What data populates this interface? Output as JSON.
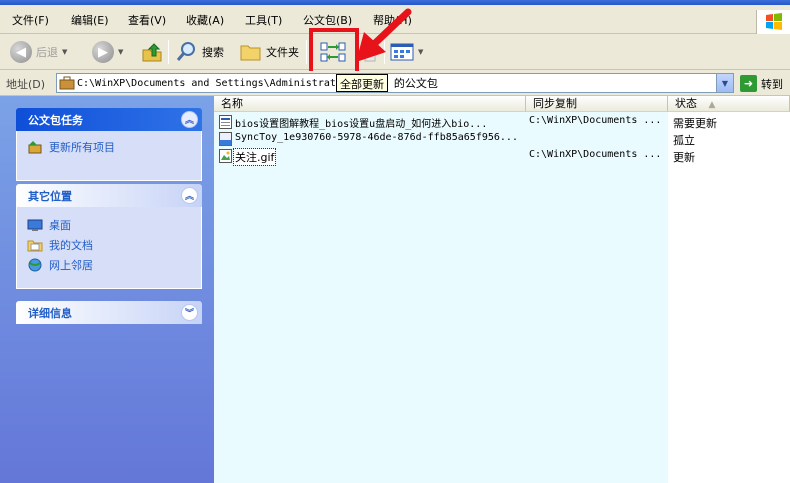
{
  "menu": [
    {
      "label": "文件(F)",
      "name": "menu-file"
    },
    {
      "label": "编辑(E)",
      "name": "menu-edit"
    },
    {
      "label": "查看(V)",
      "name": "menu-view"
    },
    {
      "label": "收藏(A)",
      "name": "menu-favorites"
    },
    {
      "label": "工具(T)",
      "name": "menu-tools"
    },
    {
      "label": "公文包(B)",
      "name": "menu-briefcase"
    },
    {
      "label": "帮助(H)",
      "name": "menu-help"
    }
  ],
  "toolbar": {
    "back_label": "后退",
    "search_label": "搜索",
    "folders_label": "文件夹"
  },
  "address": {
    "label": "地址(D)",
    "value": "C:\\WinXP\\Documents and Settings\\Administrat",
    "value_tail": "的公文包",
    "go_label": "转到"
  },
  "tooltip": "全部更新",
  "taskpane": {
    "briefcase_tasks": {
      "title": "公文包任务",
      "items": [
        "更新所有项目"
      ]
    },
    "other_places": {
      "title": "其它位置",
      "items": [
        "桌面",
        "我的文档",
        "网上邻居"
      ]
    },
    "details": {
      "title": "详细信息"
    }
  },
  "columns": {
    "name": "名称",
    "sync": "同步复制",
    "status": "状态"
  },
  "files": [
    {
      "name": "bios设置图解教程_bios设置u盘启动_如何进入bio...",
      "sync": "C:\\WinXP\\Documents ...",
      "status": "需要更新",
      "icon": "webpage-file-icon"
    },
    {
      "name": "SyncToy_1e930760-5978-46de-876d-ffb85a65f956...",
      "sync": "",
      "status": "孤立",
      "icon": "dat-file-icon"
    },
    {
      "name": "关注.gif",
      "sync": "C:\\WinXP\\Documents ...",
      "status": "更新",
      "icon": "image-file-icon"
    }
  ]
}
